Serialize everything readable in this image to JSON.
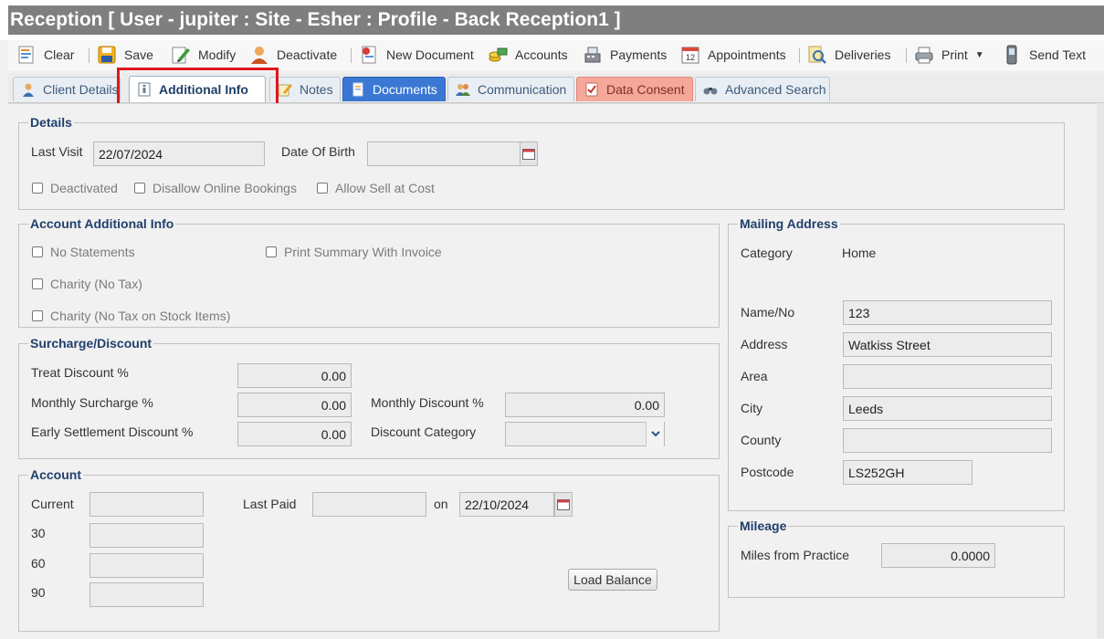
{
  "title": "Reception [ User - jupiter : Site - Esher : Profile - Back Reception1 ]",
  "toolbar": {
    "clear": "Clear",
    "save": "Save",
    "modify": "Modify",
    "deactivate": "Deactivate",
    "new_document": "New Document",
    "accounts": "Accounts",
    "payments": "Payments",
    "appointments": "Appointments",
    "deliveries": "Deliveries",
    "print": "Print",
    "send_text": "Send Text"
  },
  "tabs": [
    "Client Details",
    "Additional Info",
    "Notes",
    "Documents",
    "Communication",
    "Data Consent",
    "Advanced Search"
  ],
  "active_tab": "Additional Info",
  "details": {
    "legend": "Details",
    "last_visit_label": "Last Visit",
    "last_visit": "22/07/2024",
    "dob_label": "Date Of Birth",
    "dob": "",
    "deactivated": "Deactivated",
    "disallow_online": "Disallow Online Bookings",
    "allow_sell": "Allow Sell at Cost"
  },
  "account_info": {
    "legend": "Account Additional Info",
    "no_statements": "No Statements",
    "print_summary": "Print Summary With Invoice",
    "charity": "Charity (No Tax)",
    "charity_stock": "Charity (No Tax on Stock Items)"
  },
  "surcharge": {
    "legend": "Surcharge/Discount",
    "treat_label": "Treat Discount %",
    "treat": "0.00",
    "monthly_sur_label": "Monthly Surcharge %",
    "monthly_sur": "0.00",
    "monthly_disc_label": "Monthly Discount %",
    "monthly_disc": "0.00",
    "early_label": "Early Settlement Discount %",
    "early": "0.00",
    "disc_cat_label": "Discount Category",
    "disc_cat": ""
  },
  "account": {
    "legend": "Account",
    "current_label": "Current",
    "current": "",
    "last_paid_label": "Last Paid",
    "last_paid": "",
    "on_label": "on",
    "on_date": "22/10/2024",
    "d30_label": "30",
    "d30": "",
    "d60_label": "60",
    "d60": "",
    "d90_label": "90",
    "d90": "",
    "load_balance": "Load Balance"
  },
  "mailing": {
    "legend": "Mailing Address",
    "category_label": "Category",
    "category": "Home",
    "name_label": "Name/No",
    "name": "123",
    "address_label": "Address",
    "address": "Watkiss Street",
    "area_label": "Area",
    "area": "",
    "city_label": "City",
    "city": "Leeds",
    "county_label": "County",
    "county": "",
    "postcode_label": "Postcode",
    "postcode": "LS252GH"
  },
  "mileage": {
    "legend": "Mileage",
    "miles_label": "Miles from Practice",
    "miles": "0.0000"
  },
  "colors": {
    "title_bar": "#7f7f7f",
    "highlight": "#e0171c",
    "documents_tab": "#3a78d4",
    "data_consent_tab": "#f5a79a",
    "legend_text": "#203f6b"
  }
}
